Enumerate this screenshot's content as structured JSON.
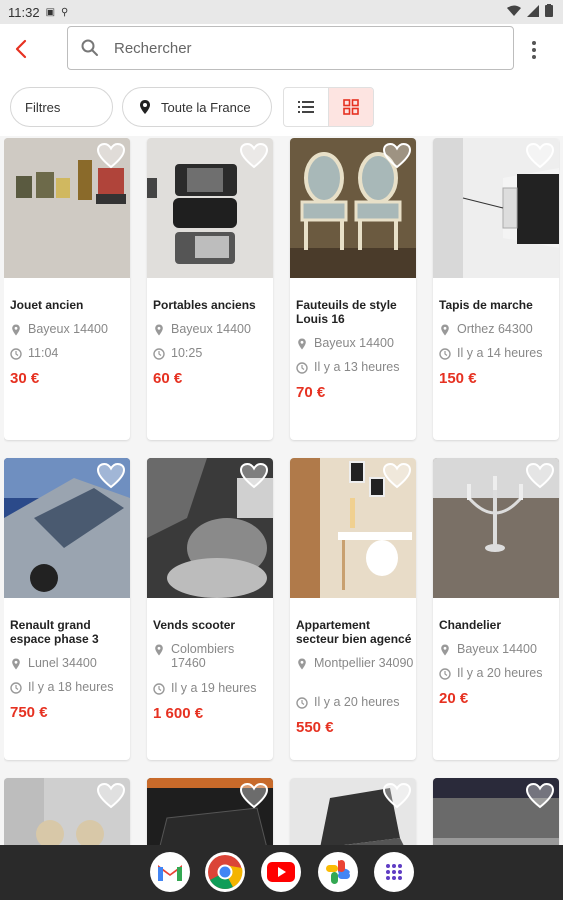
{
  "status": {
    "time": "11:32"
  },
  "search": {
    "placeholder": "Rechercher"
  },
  "filters": {
    "filters_label": "Filtres",
    "location_label": "Toute la France"
  },
  "colors": {
    "accent": "#e63121",
    "accent_light": "#fde4e1"
  },
  "listings": [
    {
      "title": "Jouet ancien",
      "location": "Bayeux 14400",
      "time": "11:04",
      "price": "30 €"
    },
    {
      "title": "Portables anciens",
      "location": "Bayeux 14400",
      "time": "10:25",
      "price": "60 €"
    },
    {
      "title": "Fauteuils de style Louis 16",
      "location": "Bayeux 14400",
      "time": "Il y a 13 heures",
      "price": "70 €"
    },
    {
      "title": "Tapis de marche",
      "location": "Orthez 64300",
      "time": "Il y a 14 heures",
      "price": "150 €"
    },
    {
      "title": "Renault grand espace phase 3",
      "location": "Lunel 34400",
      "time": "Il y a 18 heures",
      "price": "750 €"
    },
    {
      "title": "Vends scooter",
      "location": "Colombiers 17460",
      "time": "Il y a 19 heures",
      "price": "1 600 €"
    },
    {
      "title": "Appartement secteur bien agencé",
      "location": "Montpellier 34090",
      "time": "Il y a 20 heures",
      "price": "550 €"
    },
    {
      "title": "Chandelier",
      "location": "Bayeux 14400",
      "time": "Il y a 20 heures",
      "price": "20 €"
    }
  ],
  "dock_apps": [
    "gmail-icon",
    "chrome-icon",
    "youtube-icon",
    "photos-icon",
    "app-drawer-icon"
  ]
}
